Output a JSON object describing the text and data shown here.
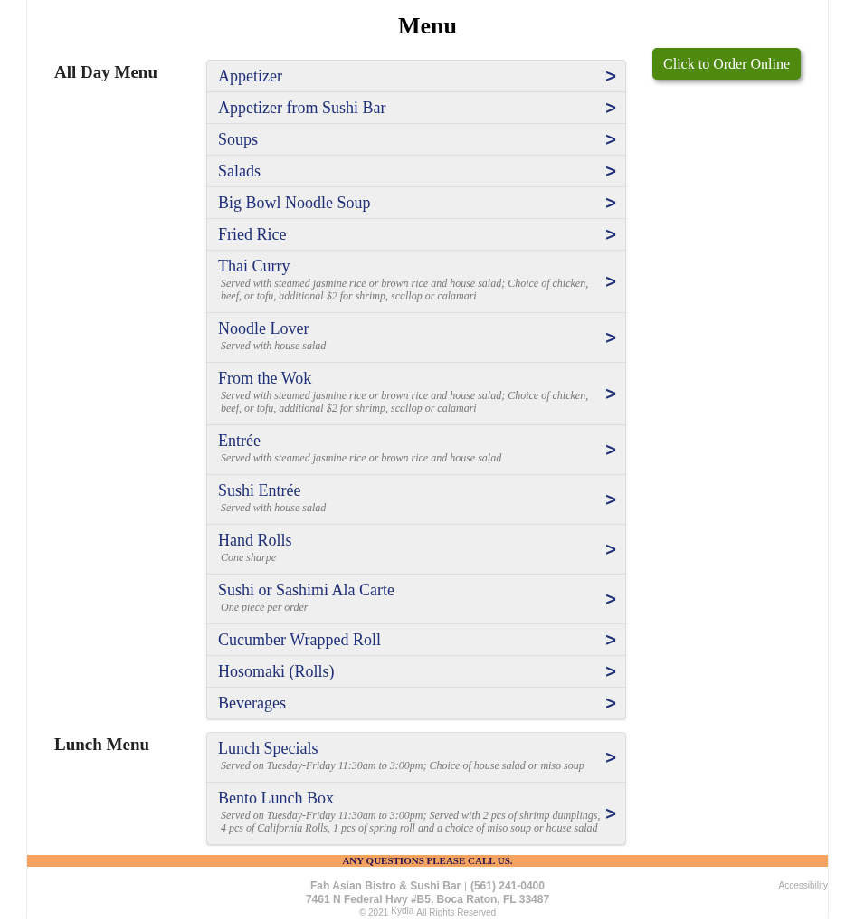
{
  "title": "Menu",
  "order_button": "Click to Order Online",
  "sections": [
    {
      "title": "All Day Menu",
      "items": [
        {
          "name": "Appetizer",
          "arrow": ">"
        },
        {
          "name": "Appetizer from Sushi Bar",
          "arrow": ">"
        },
        {
          "name": "Soups",
          "arrow": ">"
        },
        {
          "name": "Salads",
          "arrow": ">"
        },
        {
          "name": "Big Bowl Noodle Soup",
          "arrow": ">"
        },
        {
          "name": "Fried Rice",
          "arrow": ">"
        },
        {
          "name": "Thai Curry",
          "description": "Served with steamed jasmine rice or brown rice and house salad; Choice of chicken, beef, or tofu, additional $2 for shrimp, scallop or calamari",
          "arrow": ">"
        },
        {
          "name": "Noodle Lover",
          "description": "Served with house salad",
          "arrow": ">"
        },
        {
          "name": "From the Wok",
          "description": "Served with steamed jasmine rice or brown rice and house salad; Choice of chicken, beef, or tofu, additional $2 for shrimp, scallop or calamari",
          "arrow": ">"
        },
        {
          "name": "Entrée",
          "description": "Served with steamed jasmine rice or brown rice and house salad",
          "arrow": ">"
        },
        {
          "name": "Sushi Entrée",
          "description": "Served with house salad",
          "arrow": ">"
        },
        {
          "name": "Hand Rolls",
          "description": "Cone sharpe",
          "arrow": ">"
        },
        {
          "name": "Sushi or Sashimi Ala Carte",
          "description": "One piece per order",
          "arrow": ">"
        },
        {
          "name": "Cucumber Wrapped Roll",
          "arrow": ">"
        },
        {
          "name": "Hosomaki (Rolls)",
          "arrow": ">"
        },
        {
          "name": "Beverages",
          "arrow": ">"
        }
      ]
    },
    {
      "title": "Lunch Menu",
      "items": [
        {
          "name": "Lunch Specials",
          "description": "Served on Tuesday-Friday 11:30am to 3:00pm; Choice of house salad or miso soup",
          "arrow": ">"
        },
        {
          "name": "Bento Lunch Box",
          "description": "Served on Tuesday-Friday 11:30am to 3:00pm; Served with 2 pcs of shrimp dumplings, 4 pcs of California Rolls, 1 pcs of spring roll and a choice of miso soup or house salad",
          "arrow": ">"
        }
      ]
    }
  ],
  "banner": "ANY QUESTIONS PLEASE CALL US.",
  "footer": {
    "business": "Fah Asian Bistro & Sushi Bar",
    "separator": "|",
    "phone": "(561) 241-0400",
    "address": "7461 N Federal Hwy #B5, Boca Raton, FL 33487",
    "copyright": "© 2021",
    "brand": "Kydia",
    "rights": "All Rights Reserved",
    "accessibility": "Accessibility"
  }
}
